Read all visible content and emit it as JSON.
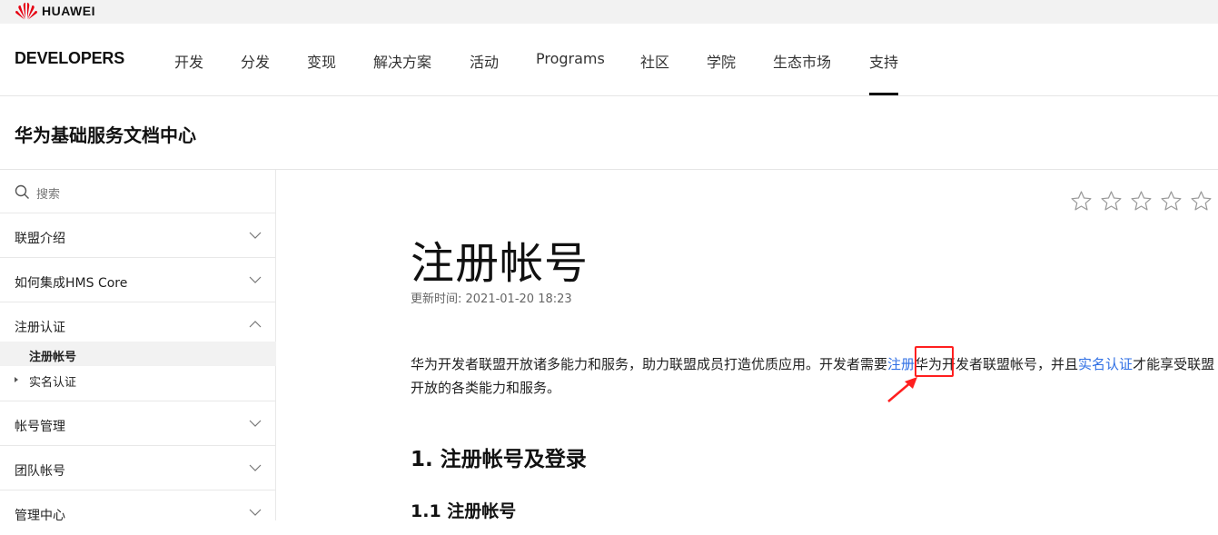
{
  "brand": {
    "logo_text": "HUAWEI",
    "logo_color": "#e60012"
  },
  "nav": {
    "site": "DEVELOPERS",
    "items": [
      "开发",
      "分发",
      "变现",
      "解决方案",
      "活动",
      "Programs",
      "社区",
      "学院",
      "生态市场",
      "支持"
    ],
    "active": "支持"
  },
  "doc_center": {
    "title": "华为基础服务文档中心"
  },
  "sidebar": {
    "search_placeholder": "搜索",
    "groups": [
      {
        "label": "联盟介绍",
        "expanded": false
      },
      {
        "label": "如何集成HMS Core",
        "expanded": false
      },
      {
        "label": "注册认证",
        "expanded": true,
        "children": [
          {
            "label": "注册帐号",
            "active": true
          },
          {
            "label": "实名认证",
            "has_children": true
          }
        ]
      },
      {
        "label": "帐号管理",
        "expanded": false
      },
      {
        "label": "团队帐号",
        "expanded": false
      },
      {
        "label": "管理中心",
        "expanded": false
      }
    ]
  },
  "rating": {
    "stars": 5,
    "filled": 0
  },
  "article": {
    "title": "注册帐号",
    "updated": "更新时间: 2021-01-20 18:23",
    "para_part1": "华为开发者联盟开放诸多能力和服务，助力联盟成员打造优质应用。开发者需要",
    "link_register": "注册",
    "para_part2": "华为开发者联盟帐号，并且",
    "link_realname": "实名认证",
    "para_part3": "才能享受联盟开放的各类能力和服务。",
    "h2": "1. 注册帐号及登录",
    "h3": "1.1 注册帐号"
  },
  "colors": {
    "link": "#2f6fe4",
    "highlight": "#ff1f1f"
  }
}
